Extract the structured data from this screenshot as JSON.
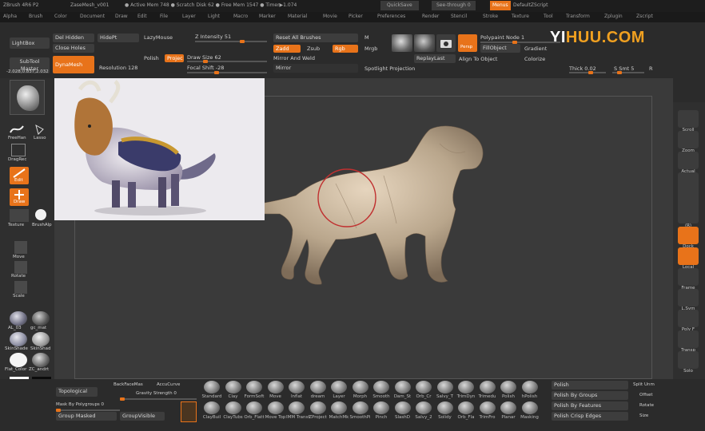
{
  "titlebar": {
    "app": "ZBrush 4R6 P2",
    "doc": "ZaseMesh_v001",
    "stats": "● Active Mem 748 ● Scratch Disk 62 ● Free Mem 1547 ● Timer▶1.074",
    "quicksave": "QuickSave",
    "seethrough": "See-through  0",
    "menus": "Menus",
    "script": "DefaultZScript"
  },
  "watermark": {
    "prefix": "YI",
    "rest": "HUU.COM"
  },
  "menubar": [
    "Alpha",
    "Brush",
    "Color",
    "Document",
    "Draw",
    "Edit",
    "File",
    "Layer",
    "Light",
    "Macro",
    "Marker",
    "Material",
    "Movie",
    "Picker",
    "Preferences",
    "Render",
    "Stencil",
    "Stroke",
    "Texture",
    "Tool",
    "Transform",
    "Zplugin",
    "Zscript"
  ],
  "toolbar": {
    "lightbox": "LightBox",
    "subtool_master": "SubTool Master",
    "del_hidden": "Del Hidden",
    "hide_pt": "HidePt",
    "lazy_mouse": "LazyMouse",
    "close_holes": "Close Holes",
    "dynamesh": "DynaMesh",
    "polish": "Polish",
    "project": "Projec",
    "resolution": "Resolution 128",
    "z_intensity": "Z Intensity 51",
    "draw_size": "Draw Size 62",
    "focal_shift": "Focal Shift -28",
    "reset_brushes": "Reset All Brushes",
    "zadd": "Zadd",
    "zsub": "Zsub",
    "rgb": "Rgb",
    "m": "M",
    "mrgb": "Mrgb",
    "mirror_weld": "Mirror And Weld",
    "mirror": "Mirror",
    "spotlight": "Spotlight Projection",
    "replaylast": "ReplayLast",
    "align": "Align To Object",
    "polypaint_node": "Polypaint Node 1",
    "fillobject": "FillObject",
    "gradient": "Gradient",
    "colorize": "Colorize",
    "thick": "Thick 0.02",
    "s_smt": "S Smt 5",
    "r": "R",
    "persp": "Persp",
    "coords": "-2.028,0.837,2.032"
  },
  "left": {
    "strokes": "FreeHan",
    "lasso": "Lasso",
    "dragrect": "DragRec",
    "edit": "Edit",
    "draw": "Draw",
    "texture": "Texture",
    "brushalpha": "BrushAlp",
    "move": "Move",
    "rotate": "Rotate",
    "scale": "Scale",
    "mats": [
      "AL_03",
      "gc_mat",
      "SkinShade",
      "SkinShad",
      "Flat_Color",
      "ZC_andrt"
    ]
  },
  "right": [
    "Scroll",
    "Zoom",
    "Actual",
    "XYZ",
    "XYZ",
    "XYZ",
    "(R)",
    "Dock",
    "Local",
    "Frame",
    "L.Sym",
    "Poly F",
    "Transp",
    "Solo"
  ],
  "bottom": {
    "topological": "Topological",
    "backface": "BackFaceMas",
    "accucurve": "AccuCurve",
    "gravity": "Gravity Strength 0",
    "mask_poly": "Mask By Polygroups 0",
    "group_masked": "Group Masked",
    "group_visible": "GroupVisible",
    "brushes_row1": [
      "Standard",
      "Clay",
      "FormSoft",
      "Move",
      "Inflat",
      "dream",
      "Layer",
      "Morph",
      "Smooth",
      "Dam_St",
      "Orb_Cr",
      "Salvy_T",
      "TrimDyn",
      "Trimedu",
      "Polish",
      "hPolish"
    ],
    "brushes_row2": [
      "ClayBuil",
      "ClayTubs",
      "Orb_Flatt",
      "Move Top",
      "IMM Transf",
      "ZProject",
      "MatchMk",
      "SmoothPi",
      "Pinch",
      "SlashD",
      "Salvy_2",
      "Solidy",
      "Orb_Fla",
      "TrimFro",
      "Planar",
      "Masking"
    ],
    "polish": "Polish",
    "polish_groups": "Polish By Groups",
    "polish_features": "Polish By Features",
    "polish_crisp": "Polish Crisp Edges",
    "split_unmasked": "Split Unm",
    "offset": "Offset",
    "rotate": "Rotate",
    "size": "Size"
  }
}
